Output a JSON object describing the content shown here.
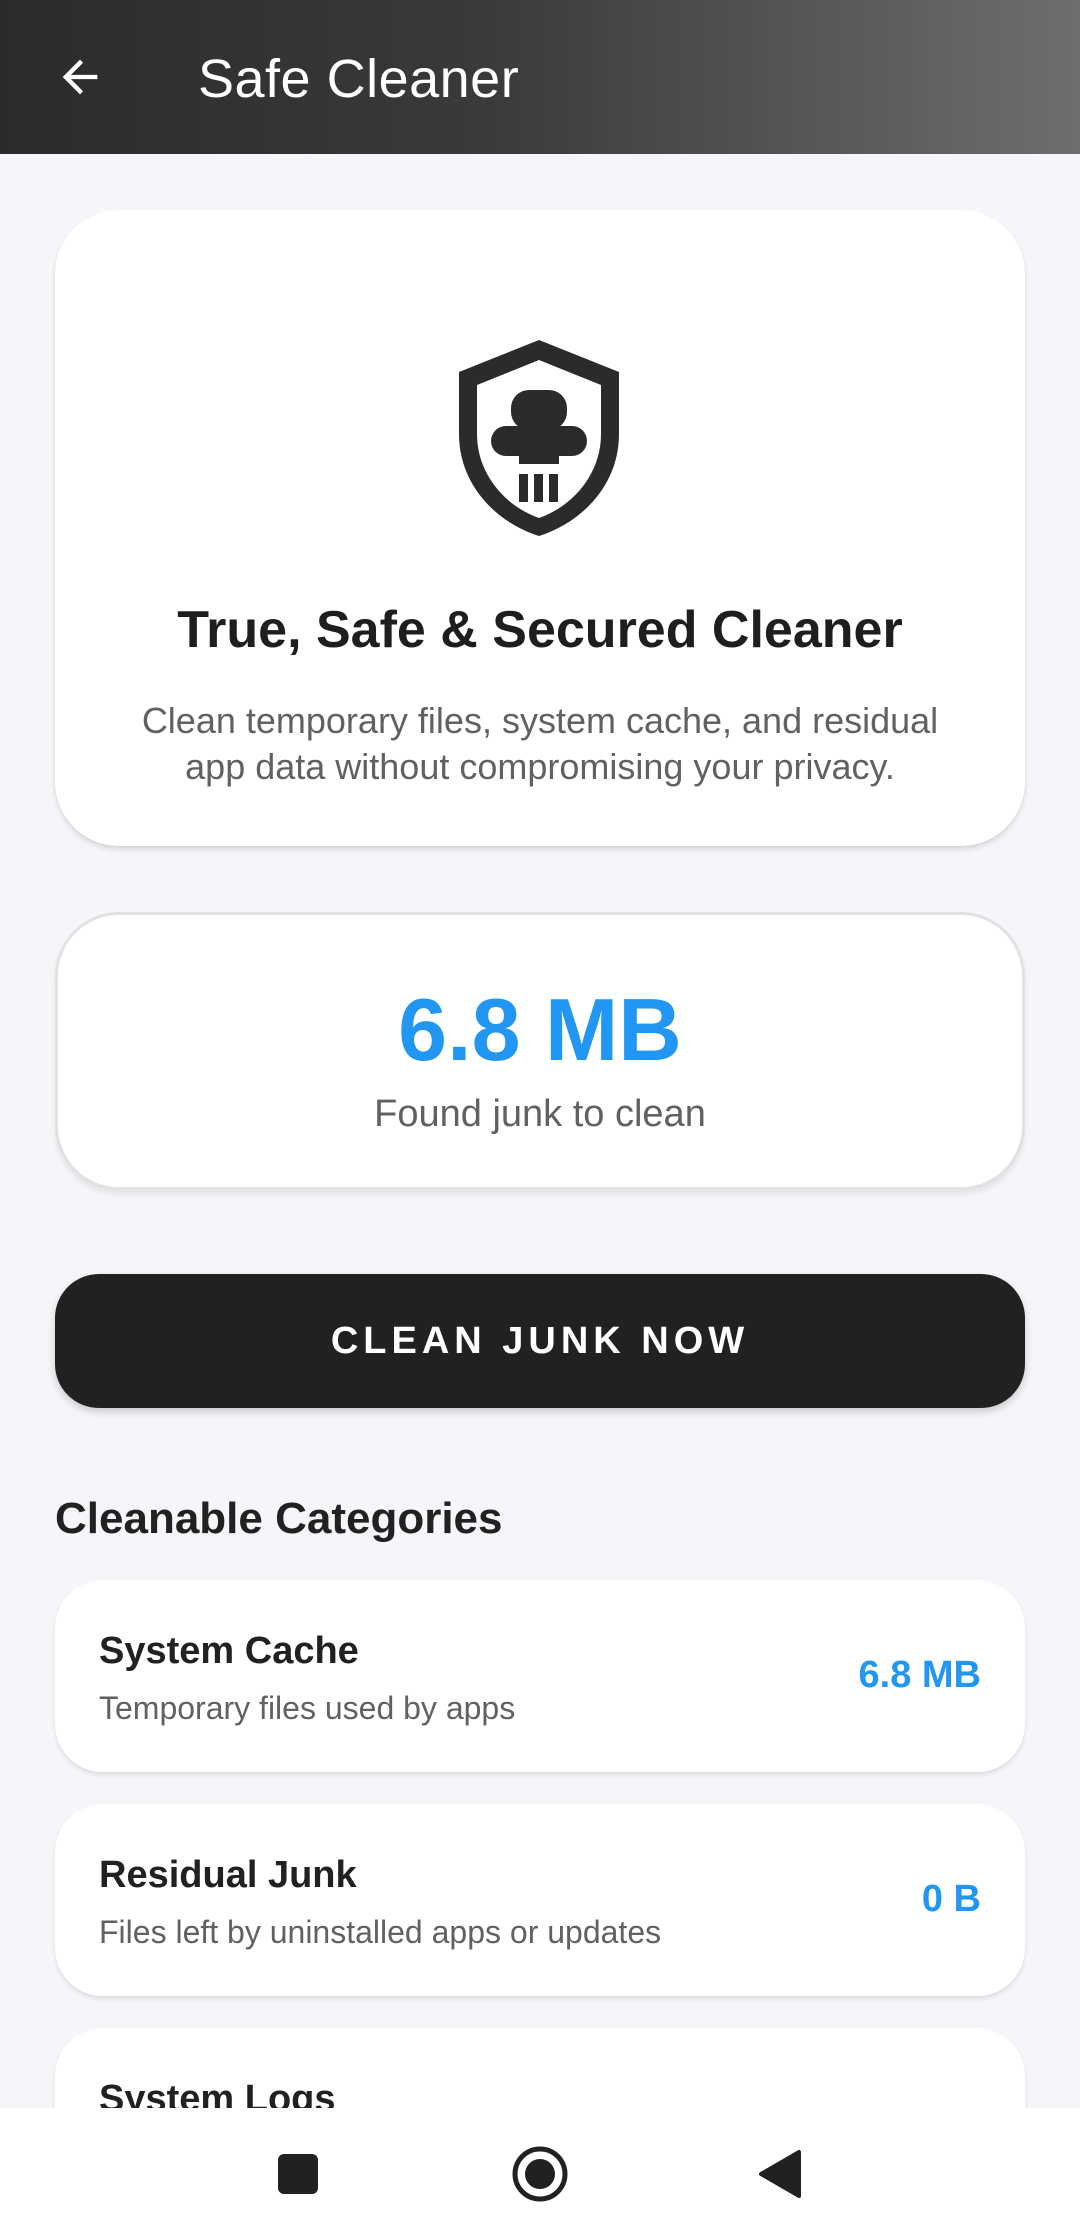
{
  "app_bar": {
    "title": "Safe Cleaner",
    "back_icon": "arrow-left-icon"
  },
  "hero": {
    "icon": "shield-cleaner-icon",
    "title": "True, Safe & Secured Cleaner",
    "description": "Clean temporary files, system cache, and residual app data without compromising your privacy."
  },
  "junk": {
    "size": "6.8 MB",
    "label": "Found junk to clean"
  },
  "clean_button": {
    "label": "CLEAN JUNK NOW"
  },
  "categories": {
    "title": "Cleanable Categories",
    "items": [
      {
        "name": "System Cache",
        "description": "Temporary files used by apps",
        "size": "6.8 MB"
      },
      {
        "name": "Residual Junk",
        "description": "Files left by uninstalled apps or updates",
        "size": "0 B"
      },
      {
        "name": "System Logs",
        "description": "",
        "size": ""
      }
    ]
  },
  "nav_bar": {
    "recents_icon": "square-recents-icon",
    "home_icon": "circle-home-icon",
    "back_icon": "triangle-back-icon"
  },
  "colors": {
    "accent": "#2196f3",
    "button": "#212121",
    "background": "#f4f6f9"
  }
}
